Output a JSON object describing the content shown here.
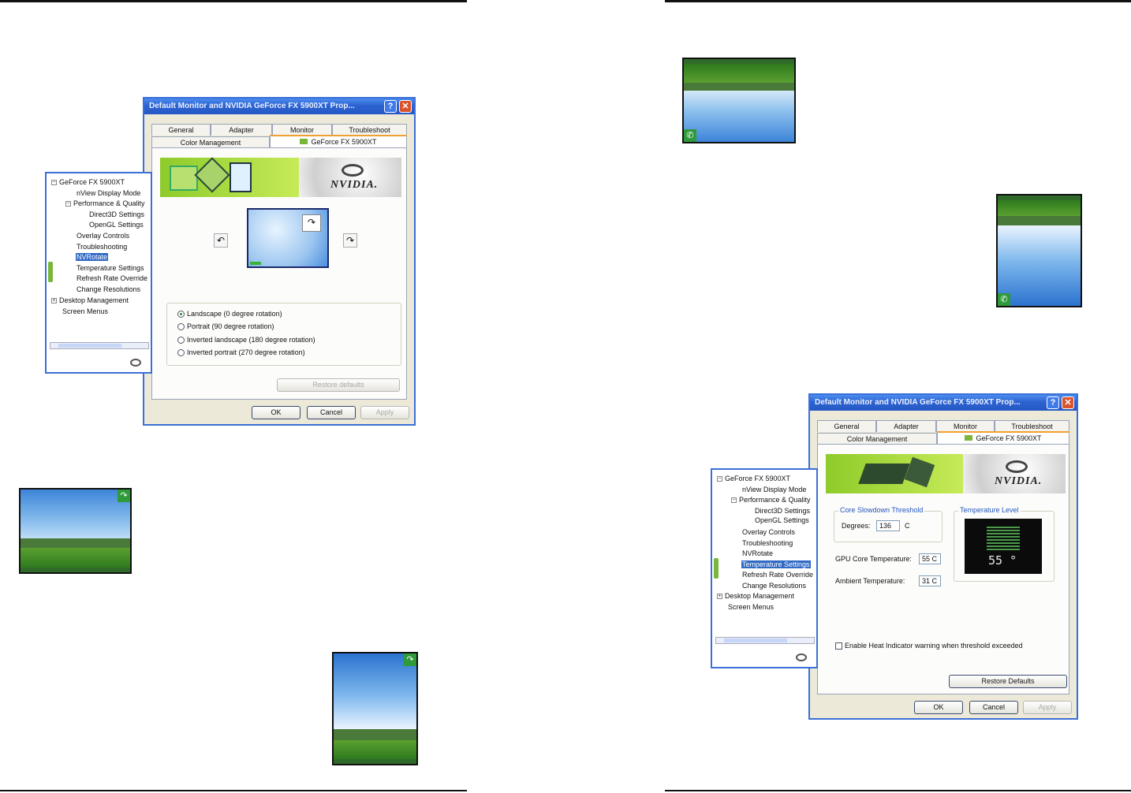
{
  "left_dialog": {
    "title": "Default Monitor and NVIDIA GeForce FX 5900XT Prop...",
    "tabs_row1": [
      "General",
      "Adapter",
      "Monitor",
      "Troubleshoot"
    ],
    "tabs_row2": [
      "Color Management",
      "GeForce FX 5900XT"
    ],
    "rotation_options": [
      "Landscape (0 degree rotation)",
      "Portrait (90 degree rotation)",
      "Inverted landscape (180 degree rotation)",
      "Inverted portrait (270 degree rotation)"
    ],
    "restore_label": "Restore defaults",
    "ok": "OK",
    "cancel": "Cancel",
    "apply": "Apply",
    "brand": "NVIDIA."
  },
  "left_tree": {
    "items": [
      "GeForce FX 5900XT",
      "nView Display Mode",
      "Performance & Quality",
      "Direct3D Settings",
      "OpenGL Settings",
      "Overlay Controls",
      "Troubleshooting",
      "NVRotate",
      "Temperature Settings",
      "Refresh Rate Override",
      "Change Resolutions",
      "Desktop Management",
      "Screen Menus"
    ],
    "selected": "NVRotate"
  },
  "right_dialog": {
    "title": "Default Monitor and NVIDIA GeForce FX 5900XT Prop...",
    "tabs_row1": [
      "General",
      "Adapter",
      "Monitor",
      "Troubleshoot"
    ],
    "tabs_row2": [
      "Color Management",
      "GeForce FX 5900XT"
    ],
    "slowdown_group": "Core Slowdown Threshold",
    "degrees_label": "Degrees:",
    "degrees_value": "136",
    "degrees_unit": "C",
    "temp_level_group": "Temperature Level",
    "temp_display": "55 °",
    "gpu_core_label": "GPU Core Temperature:",
    "gpu_core_value": "55 C",
    "ambient_label": "Ambient Temperature:",
    "ambient_value": "31 C",
    "heat_checkbox": "Enable Heat Indicator warning when threshold exceeded",
    "restore_label": "Restore Defaults",
    "ok": "OK",
    "cancel": "Cancel",
    "apply": "Apply",
    "brand": "NVIDIA."
  },
  "right_tree": {
    "items": [
      "GeForce FX 5900XT",
      "nView Display Mode",
      "Performance & Quality",
      "Direct3D Settings",
      "OpenGL Settings",
      "Overlay Controls",
      "Troubleshooting",
      "NVRotate",
      "Temperature Settings",
      "Refresh Rate Override",
      "Change Resolutions",
      "Desktop Management",
      "Screen Menus"
    ],
    "selected": "Temperature Settings"
  },
  "icons": [
    "rotate-left-icon",
    "rotate-right-icon",
    "nvidia-eye-icon",
    "phone-icon",
    "rotate-icon"
  ],
  "colors": {
    "accent": "#3a6fd8",
    "nvidia_green": "#8ecb2a",
    "selection": "#316ac5"
  }
}
